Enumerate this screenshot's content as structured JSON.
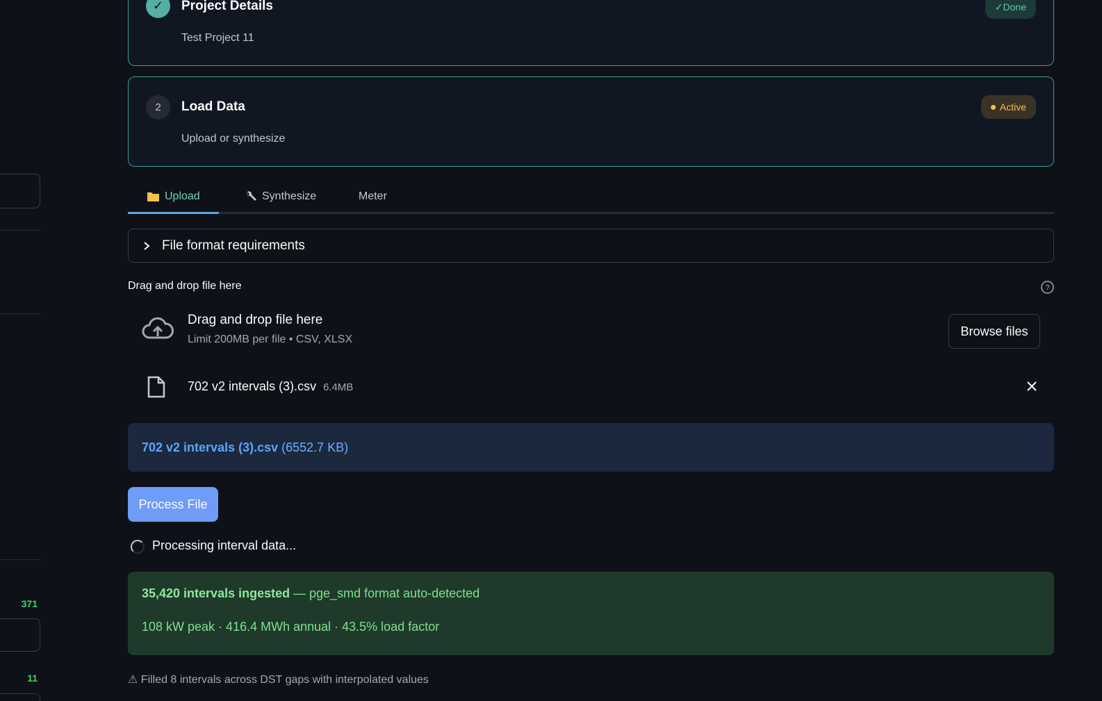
{
  "sidebar": {
    "numbers": [
      "371",
      "11"
    ]
  },
  "steps": [
    {
      "icon": "✓",
      "title": "Project Details",
      "subtitle": "Test Project 11",
      "badge": "✓Done"
    },
    {
      "icon": "2",
      "title": "Load Data",
      "subtitle": "Upload or synthesize",
      "badge": "Active"
    }
  ],
  "tabs": [
    {
      "label": "Upload",
      "icon": "folder-icon",
      "active": true
    },
    {
      "label": "Synthesize",
      "icon": "wrench-icon",
      "active": false
    },
    {
      "label": "Meter",
      "active": false
    }
  ],
  "expander": {
    "label": "File format requirements"
  },
  "uploader": {
    "label": "Drag and drop file here",
    "dropzone_title": "Drag and drop file here",
    "dropzone_limit": "Limit 200MB per file • CSV, XLSX",
    "browse_label": "Browse files",
    "file_name": "702 v2 intervals (3).csv",
    "file_size": "6.4MB"
  },
  "info": {
    "file_name": "702 v2 intervals (3).csv",
    "file_size": "(6552.7 KB)"
  },
  "process_button": "Process File",
  "spinner_text": "Processing interval data...",
  "success": {
    "bold": "35,420 intervals ingested",
    "rest": " — pge_smd format auto-detected",
    "stats": "108 kW peak · 416.4 MWh annual · 43.5% load factor"
  },
  "warning": "⚠ Filled 8 intervals across DST gaps with interpolated values",
  "colors": {
    "background": "#0e1117",
    "accent_teal": "#3e9c8f",
    "primary_button": "#6f9cf7",
    "success_bg": "#1f3a2a",
    "info_bg": "#1c283d"
  }
}
